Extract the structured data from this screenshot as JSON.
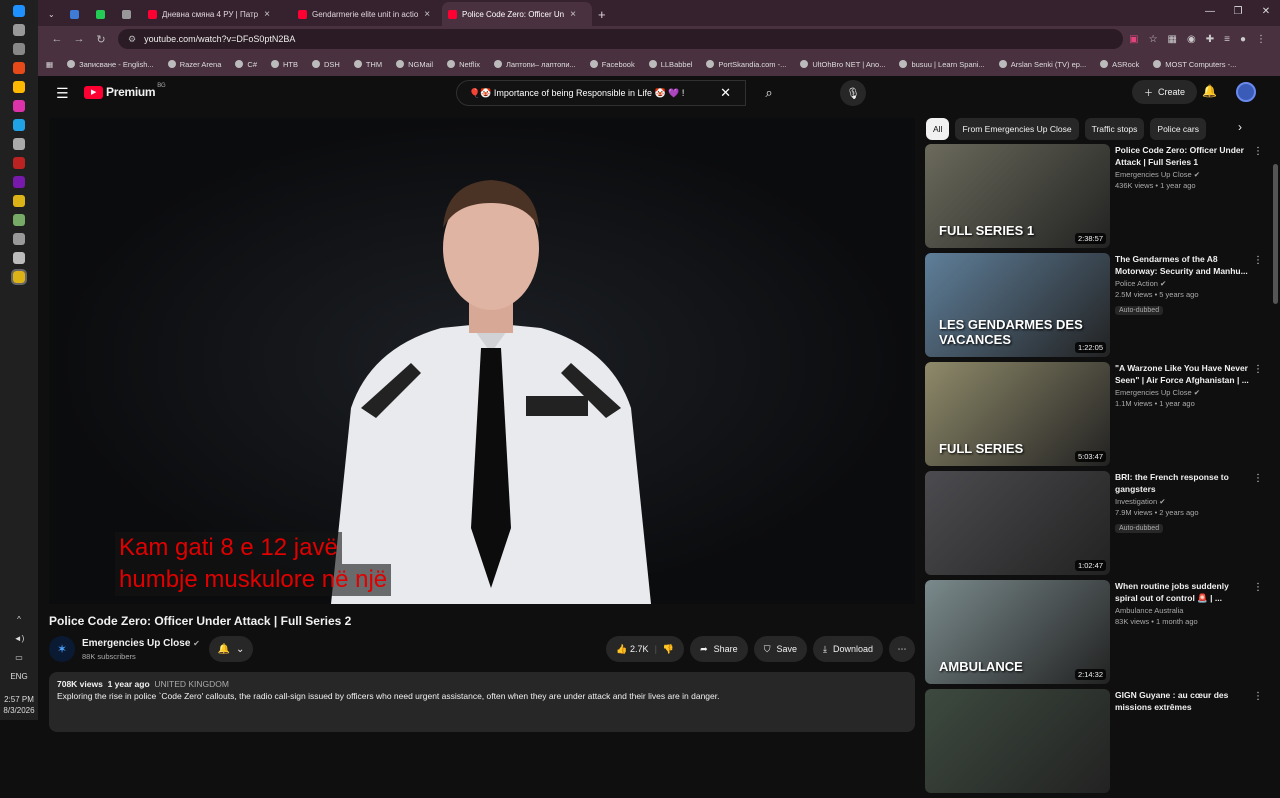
{
  "taskbar": {
    "lang": "ENG",
    "time": "2:57 PM",
    "date": "8/3/2026"
  },
  "browser": {
    "tabs": [
      {
        "label": "Дневна смяна 4 РУ | Патр",
        "color": "#ff0033"
      },
      {
        "label": "Gendarmerie elite unit in actio",
        "color": "#ff0033"
      },
      {
        "label": "Police Code Zero: Officer Un",
        "color": "#ff0033",
        "active": true
      }
    ],
    "url": "youtube.com/watch?v=DFoS0ptN2BA",
    "bookmarks": [
      "Записване - English...",
      "Razer Arena",
      "C#",
      "НТВ",
      "DSH",
      "THM",
      "NGMail",
      "Netflix",
      "Лаптопи– лаптопи...",
      "Facebook",
      "LLBabbel",
      "PortSkandia.com -...",
      "UltOhBro NET | Ano...",
      "busuu | Learn Spani...",
      "Arslan Senki (TV) ep...",
      "ASRock",
      "MOST Computers -..."
    ]
  },
  "youtube": {
    "logo": "Premium",
    "logo_region": "BG",
    "search_query": "🎈🤡 Importance of being Responsible in Life 🤡 💜 !",
    "create_label": "Create",
    "video": {
      "caption_line1": "Kam gati 8 e 12 javë",
      "caption_line2": "humbje muskulore në një",
      "title": "Police Code Zero: Officer Under Attack | Full Series 2",
      "channel": "Emergencies Up Close",
      "subscribers": "88K subscribers",
      "likes": "2.7K",
      "share_label": "Share",
      "save_label": "Save",
      "download_label": "Download",
      "views": "708K views",
      "age": "1 year ago",
      "location": "UNITED KINGDOM",
      "description": "Exploring the rise in police `Code Zero' callouts, the radio call-sign issued by officers who need urgent assistance, often when they are under attack and their lives are in danger."
    },
    "chips": [
      "All",
      "From Emergencies Up Close",
      "Traffic stops",
      "Police cars"
    ],
    "recommendations": [
      {
        "title": "Police Code Zero: Officer Under Attack | Full Series 1",
        "channel": "Emergencies Up Close",
        "verified": true,
        "meta": "436K views • 1 year ago",
        "duration": "2:38:57",
        "thumb_text": "FULL SERIES 1",
        "thumb_color": "#6b6a5c"
      },
      {
        "title": "The Gendarmes of the A8 Motorway: Security and Manhu...",
        "channel": "Police Action",
        "verified": true,
        "meta": "2.5M views • 5 years ago",
        "duration": "1:22:05",
        "thumb_text": "LES GENDARMES DES VACANCES",
        "thumb_color": "#5f7f9a",
        "badge": "Auto-dubbed"
      },
      {
        "title": "\"A Warzone Like You Have Never Seen\" | Air Force Afghanistan | ...",
        "channel": "Emergencies Up Close",
        "verified": true,
        "meta": "1.1M views • 1 year ago",
        "duration": "5:03:47",
        "thumb_text": "FULL SERIES",
        "thumb_color": "#8f8a6a"
      },
      {
        "title": "BRI: the French response to gangsters",
        "channel": "Investigation",
        "verified": true,
        "meta": "7.9M views • 2 years ago",
        "duration": "1:02:47",
        "thumb_text": "",
        "thumb_color": "#4c4c50",
        "badge": "Auto-dubbed"
      },
      {
        "title": "When routine jobs suddenly spiral out of control 🚨 | ...",
        "channel": "Ambulance Australia",
        "verified": false,
        "meta": "83K views • 1 month ago",
        "duration": "2:14:32",
        "thumb_text": "AMBULANCE",
        "thumb_color": "#7a8a8c"
      },
      {
        "title": "GIGN Guyane : au cœur des missions extrêmes",
        "channel": "",
        "verified": false,
        "meta": "",
        "duration": "",
        "thumb_text": "",
        "thumb_color": "#3d4a3f"
      }
    ]
  }
}
